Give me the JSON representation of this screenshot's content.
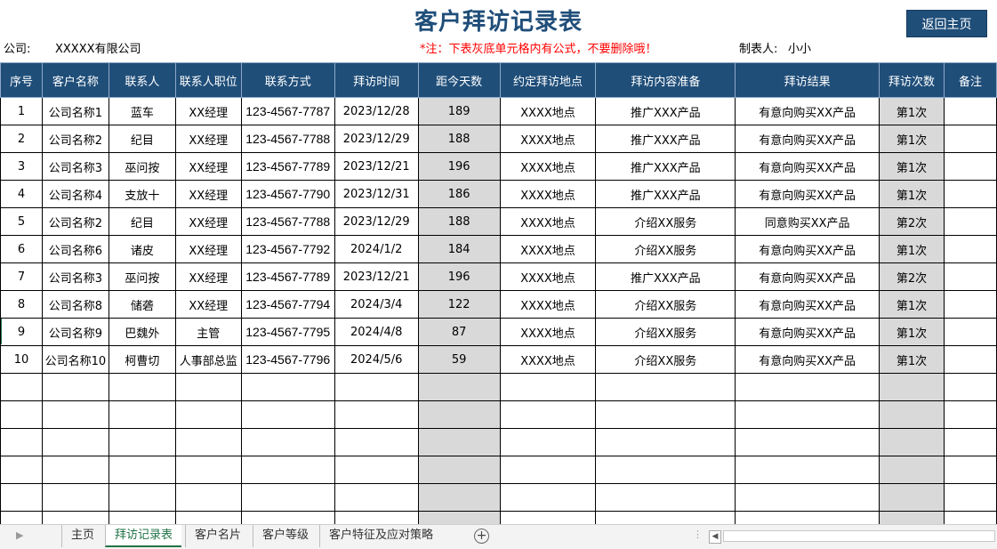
{
  "title": "客户拜访记录表",
  "back_button": "返回主页",
  "company_label": "公司:",
  "company_value": "XXXXX有限公司",
  "note": "*注：下表灰底单元格内有公式，不要删除哦！",
  "maker_label": "制表人:",
  "maker_value": "小小",
  "headers": [
    "序号",
    "客户名称",
    "联系人",
    "联系人职位",
    "联系方式",
    "拜访时间",
    "距今天数",
    "约定拜访地点",
    "拜访内容准备",
    "拜访结果",
    "拜访次数",
    "备注"
  ],
  "rows": [
    [
      "1",
      "公司名称1",
      "蓝车",
      "XX经理",
      "123-4567-7787",
      "2023/12/28",
      "189",
      "XXXX地点",
      "推广XXX产品",
      "有意向购买XX产品",
      "第1次",
      ""
    ],
    [
      "2",
      "公司名称2",
      "纪目",
      "XX经理",
      "123-4567-7788",
      "2023/12/29",
      "188",
      "XXXX地点",
      "推广XXX产品",
      "有意向购买XX产品",
      "第1次",
      ""
    ],
    [
      "3",
      "公司名称3",
      "巫问按",
      "XX经理",
      "123-4567-7789",
      "2023/12/21",
      "196",
      "XXXX地点",
      "推广XXX产品",
      "有意向购买XX产品",
      "第1次",
      ""
    ],
    [
      "4",
      "公司名称4",
      "支放十",
      "XX经理",
      "123-4567-7790",
      "2023/12/31",
      "186",
      "XXXX地点",
      "推广XXX产品",
      "有意向购买XX产品",
      "第1次",
      ""
    ],
    [
      "5",
      "公司名称2",
      "纪目",
      "XX经理",
      "123-4567-7788",
      "2023/12/29",
      "188",
      "XXXX地点",
      "介绍XX服务",
      "同意购买XX产品",
      "第2次",
      ""
    ],
    [
      "6",
      "公司名称6",
      "诸皮",
      "XX经理",
      "123-4567-7792",
      "2024/1/2",
      "184",
      "XXXX地点",
      "介绍XX服务",
      "有意向购买XX产品",
      "第1次",
      ""
    ],
    [
      "7",
      "公司名称3",
      "巫问按",
      "XX经理",
      "123-4567-7789",
      "2023/12/21",
      "196",
      "XXXX地点",
      "推广XXX产品",
      "有意向购买XX产品",
      "第2次",
      ""
    ],
    [
      "8",
      "公司名称8",
      "储砻",
      "XX经理",
      "123-4567-7794",
      "2024/3/4",
      "122",
      "XXXX地点",
      "介绍XX服务",
      "有意向购买XX产品",
      "第1次",
      ""
    ],
    [
      "9",
      "公司名称9",
      "巴魏外",
      "主管",
      "123-4567-7795",
      "2024/4/8",
      "87",
      "XXXX地点",
      "介绍XX服务",
      "有意向购买XX产品",
      "第1次",
      ""
    ],
    [
      "10",
      "公司名称10",
      "柯曹切",
      "人事部总监",
      "123-4567-7796",
      "2024/5/6",
      "59",
      "XXXX地点",
      "介绍XX服务",
      "有意向购买XX产品",
      "第1次",
      ""
    ]
  ],
  "sheet_tabs": [
    "主页",
    "拜访记录表",
    "客户名片",
    "客户等级",
    "客户特征及应对策略"
  ],
  "active_tab": "拜访记录表",
  "add_sheet_symbol": "+",
  "nav_arrow_icon": "triangle-right-icon",
  "scroll_left_icon": "triangle-left-icon",
  "colors": {
    "header_bg": "#1F4E79",
    "formula_cell_bg": "#D9D9D9",
    "note_text": "#FF0000",
    "active_tab": "#217346"
  }
}
